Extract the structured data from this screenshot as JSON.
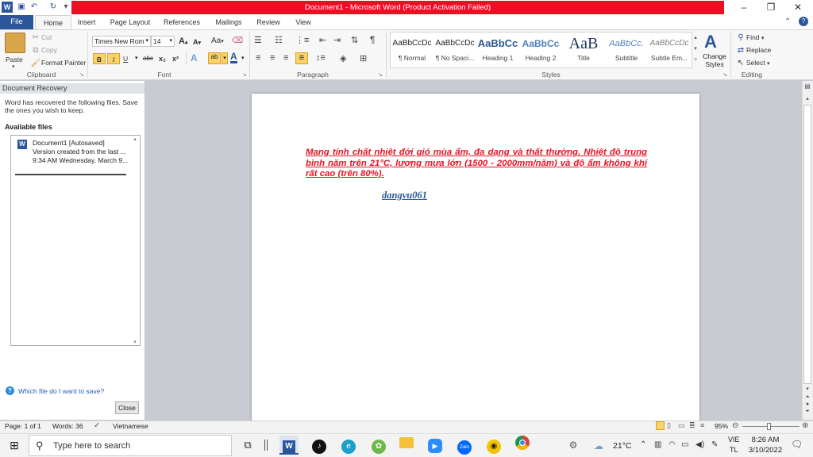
{
  "window": {
    "title": "Document1  -  Microsoft Word (Product Activation Failed)"
  },
  "qat": {
    "save": "save-icon",
    "undo": "undo-icon",
    "redo": "redo-icon"
  },
  "tabs": [
    "File",
    "Home",
    "Insert",
    "Page Layout",
    "References",
    "Mailings",
    "Review",
    "View"
  ],
  "clipboard": {
    "paste": "Paste",
    "cut": "Cut",
    "copy": "Copy",
    "format_painter": "Format Painter",
    "label": "Clipboard"
  },
  "font": {
    "name": "Times New Rom",
    "size": "14",
    "change_case": "Aa",
    "label": "Font",
    "bold": "B",
    "italic": "I",
    "underline": "U",
    "strike": "abc",
    "sub": "x₂",
    "sup": "x²",
    "grow": "A",
    "shrink": "A"
  },
  "paragraph": {
    "label": "Paragraph",
    "show_marks": "¶"
  },
  "styles": {
    "label": "Styles",
    "items": [
      {
        "preview": "AaBbCcDc",
        "name": "¶ Normal"
      },
      {
        "preview": "AaBbCcDc",
        "name": "¶ No Spaci..."
      },
      {
        "preview": "AaBbCc",
        "name": "Heading 1"
      },
      {
        "preview": "AaBbCc",
        "name": "Heading 2"
      },
      {
        "preview": "AaB",
        "name": "Title"
      },
      {
        "preview": "AaBbCc.",
        "name": "Subtitle"
      },
      {
        "preview": "AaBbCcDc",
        "name": "Subtle Em..."
      }
    ],
    "change_styles": "Change Styles"
  },
  "editing": {
    "label": "Editing",
    "find": "Find",
    "replace": "Replace",
    "select": "Select"
  },
  "recovery": {
    "title": "Document Recovery",
    "message": "Word has recovered the following files.  Save the ones you wish to keep.",
    "available": "Available files",
    "file_name": "Document1  [Autosaved]",
    "file_line2": "Version created from the last ...",
    "file_line3": "9:34 AM Wednesday, March 9...",
    "help_link": "Which file do I want to save?",
    "close": "Close"
  },
  "document": {
    "paragraph": " Mang tính chất nhiệt đới gió mùa ẩm, đa dạng và thất thường. Nhiệt độ trung bình năm trên   21°C,   lượng   mưa   lớn   (1500   -   2000mm/năm)   và   độ   ẩm không khí rất cao (trên 80%).",
    "author": "dangvu061"
  },
  "status": {
    "page": "Page: 1 of 1",
    "words": "Words: 36",
    "language": "Vietnamese",
    "zoom": "95%"
  },
  "taskbar": {
    "search_placeholder": "Type here to search",
    "weather": "21°C",
    "lang1": "VIE",
    "lang2": "TL",
    "time": "8:26 AM",
    "date": "3/10/2022"
  },
  "colors": {
    "accent": "#2b579a",
    "title_red": "#e81123",
    "doc_red": "#e81123",
    "doc_blue": "#2b579a"
  }
}
